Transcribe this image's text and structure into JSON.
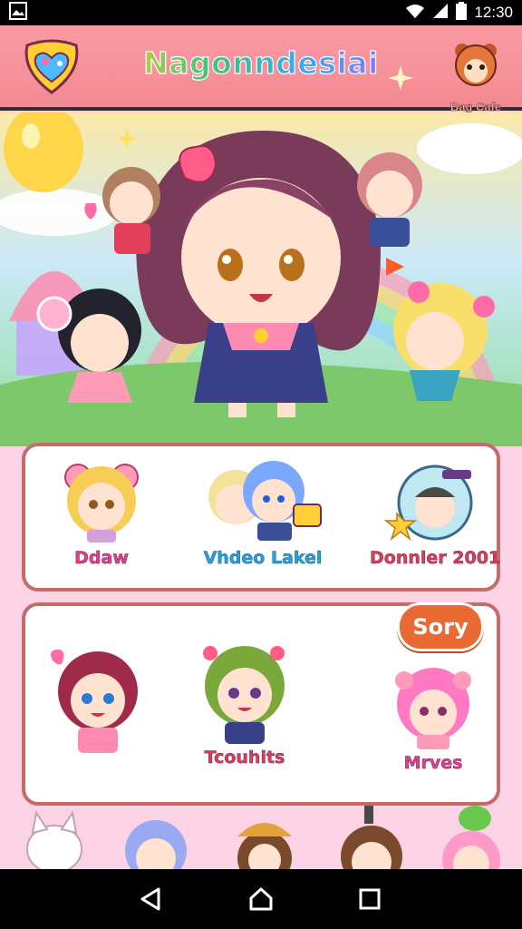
{
  "status_bar": {
    "time": "12:30",
    "icons": [
      "gallery-icon",
      "wifi-icon",
      "signal-icon",
      "battery-icon"
    ]
  },
  "header": {
    "title": "Nagonndesiai",
    "corner_badge_label": "Bag Cafe",
    "icons": [
      "heart-shield-logo-icon",
      "sparkle-icon",
      "bear-mascot-icon"
    ]
  },
  "hero": {
    "description_icons": [
      "main-chibi-character",
      "chibi-friend-top-left",
      "chibi-friend-top-right",
      "chibi-friend-left",
      "chibi-friend-right",
      "balloon-icon",
      "rainbow-icon"
    ]
  },
  "card_row_1": {
    "items": [
      {
        "label": "Ddaw",
        "icon": "blonde-chibi-icon"
      },
      {
        "label": "Vhdeo Lakel",
        "icon": "duo-chibi-icon"
      },
      {
        "label": "Donnler 2001",
        "icon": "helmet-chibi-icon"
      }
    ]
  },
  "card_row_2": {
    "button_label": "Sory",
    "items": [
      {
        "label": "",
        "icon": "redhead-chibi-icon"
      },
      {
        "label": "Tcouhits",
        "icon": "greenhair-chibi-icon"
      },
      {
        "label": "Mrves",
        "icon": "pinkhair-chibi-icon"
      }
    ]
  },
  "nav_bar": {
    "buttons": [
      "back-icon",
      "home-icon",
      "recents-icon"
    ]
  },
  "colors": {
    "header_bg": "#f48a93",
    "card_border": "#c66a6a",
    "button_orange": "#ea6a33",
    "label_pink": "#e2408e",
    "label_blue": "#2aa0d6"
  }
}
